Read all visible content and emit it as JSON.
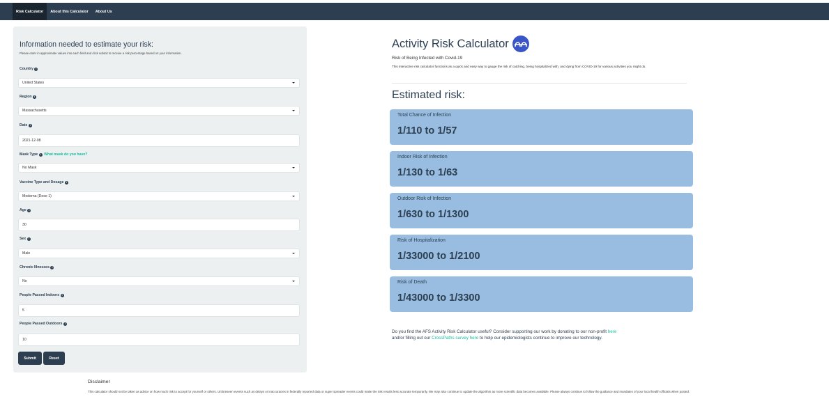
{
  "nav": {
    "tabs": [
      {
        "label": "Risk Calculator",
        "active": true
      },
      {
        "label": "About this Calculator",
        "active": false
      },
      {
        "label": "About Us",
        "active": false
      }
    ]
  },
  "form": {
    "title": "Information needed to estimate your risk:",
    "subtitle": "Please enter in approximate values into each field and click submit to receive a risk percentage based on your information.",
    "country": {
      "label": "Country",
      "value": "United States"
    },
    "region": {
      "label": "Region",
      "value": "Massachusetts"
    },
    "date": {
      "label": "Date",
      "value": "2021-12-08"
    },
    "mask": {
      "label": "Mask Type",
      "link": "What mask do you have?",
      "value": "No Mask"
    },
    "vaccine": {
      "label": "Vaccine Type and Dosage",
      "value": "Moderna (Dose 1)"
    },
    "age": {
      "label": "Age",
      "value": "30"
    },
    "sex": {
      "label": "Sex",
      "value": "Male"
    },
    "chronic": {
      "label": "Chronic Illnesses",
      "value": "No"
    },
    "indoors": {
      "label": "People Passed Indoors",
      "value": "5"
    },
    "outdoors": {
      "label": "People Passed Outdoors",
      "value": "10"
    },
    "submit_label": "Submit",
    "reset_label": "Reset"
  },
  "header": {
    "title": "Activity Risk Calculator",
    "subtitle": "Risk of Being Infected with Covid-19",
    "description": "This interactive risk calculator functions as a quick and easy way to gauge the risk of catching, being hospitalized with, and dying from COVID-19 for various activities you might do."
  },
  "results": {
    "title": "Estimated risk:",
    "cards": [
      {
        "label": "Total Chance of Infection",
        "value": "1/110 to 1/57"
      },
      {
        "label": "Indoor Risk of Infection",
        "value": "1/130 to 1/63"
      },
      {
        "label": "Outdoor Risk of Infection",
        "value": "1/630 to 1/1300"
      },
      {
        "label": "Risk of Hospitalization",
        "value": "1/33000 to 1/2100"
      },
      {
        "label": "Risk of Death",
        "value": "1/43000 to 1/3300"
      }
    ]
  },
  "support": {
    "text1": "Do you find the AFS Activity Risk Calculator useful? Consider supporting our work by donating to our non-profit",
    "link1": "here",
    "text2": "and/or filling out our",
    "link2": "CrossPaths survey here",
    "text3": "to help our epidemiologists continue to improve our technology."
  },
  "disclaimer": {
    "title": "Disclaimer",
    "text": "This calculator should not be taken as advice on how much risk to accept for yourself or others. Unforeseen events such as delays or inaccuracies in federally reported data or super spreader events could make the risk results less accurate temporarily. We may also continue to update the algorithm as more scientific data becomes available. Please always continue to follow the guidance and mandates of your local health officials when posted."
  },
  "colors": {
    "navbar": "#2c3e50",
    "panel": "#ecf0f1",
    "card": "#98bde0",
    "link": "#18bc9c",
    "logo": "#3a55c8"
  }
}
